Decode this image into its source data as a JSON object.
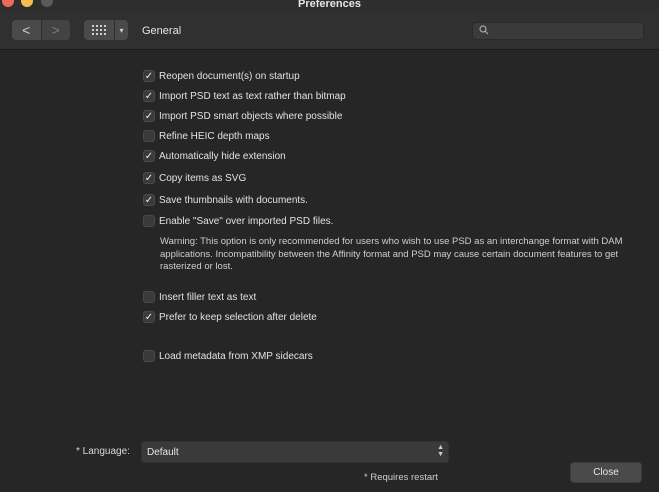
{
  "window": {
    "title": "Preferences"
  },
  "toolbar": {
    "back_glyph": "<",
    "forward_glyph": ">",
    "grid_caret": "▾",
    "section_title": "General",
    "search": {
      "value": "",
      "placeholder": ""
    }
  },
  "options": [
    {
      "label": "Reopen document(s) on startup",
      "checked": true
    },
    {
      "label": "Import PSD text as text rather than bitmap",
      "checked": true
    },
    {
      "label": "Import PSD smart objects where possible",
      "checked": true
    },
    {
      "label": "Refine HEIC depth maps",
      "checked": false
    },
    {
      "label": "Automatically hide extension",
      "checked": true
    },
    {
      "label": "Copy items as SVG",
      "checked": true
    },
    {
      "label": "Save thumbnails with documents.",
      "checked": true
    },
    {
      "label": "Enable \"Save\" over imported PSD files.",
      "checked": false
    },
    {
      "label": "Insert filler text as text",
      "checked": false
    },
    {
      "label": "Prefer to keep selection after delete",
      "checked": true
    },
    {
      "label": "Load metadata from XMP sidecars",
      "checked": false
    }
  ],
  "warning": "Warning: This option is only recommended for users who wish to use PSD as an interchange format with DAM applications. Incompatibility between the Affinity format and PSD may cause certain document features to get rasterized or lost.",
  "language": {
    "label": "* Language:",
    "value": "Default"
  },
  "restart_note": "* Requires restart",
  "close_label": "Close",
  "check_glyph": "✓"
}
